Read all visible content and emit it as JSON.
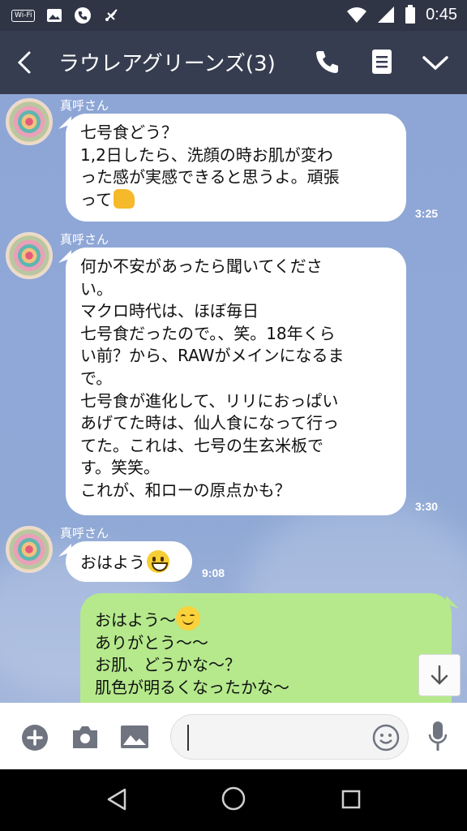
{
  "status_bar": {
    "wifi_label": "Wi-Fi",
    "time": "0:45"
  },
  "header": {
    "title": "ラウレアグリーンズ(3)"
  },
  "messages": [
    {
      "sender": "真呼さん",
      "lines": [
        "七号食どう？",
        "1,2日したら、洗顔の時お肌が変わ",
        "った感が実感できると思うよ。頑張",
        "って"
      ],
      "emoji": "thumbs-up",
      "time": "3:25"
    },
    {
      "sender": "真呼さん",
      "lines": [
        "何か不安があったら聞いてくださ",
        "い。",
        "マクロ時代は、ほぼ毎日",
        "七号食だったので。、笑。18年くら",
        "い前？から、RAWがメインになるま",
        "で。",
        "七号食が進化して、リリにおっぱい",
        "あげてた時は、仙人食になって行っ",
        "てた。これは、七号の生玄米板で",
        "す。笑笑。",
        "これが、和ローの原点かも？"
      ],
      "time": "3:30"
    },
    {
      "sender": "真呼さん",
      "lines": [
        "おはよう"
      ],
      "emoji": "grinning-face",
      "time": "9:08"
    }
  ],
  "my_message": {
    "lines": [
      "おはよう〜",
      "ありがとう〜〜",
      "お肌、どうかな〜？",
      "肌色が明るくなったかな〜"
    ],
    "emoji": "smiling-face"
  },
  "input": {
    "placeholder": ""
  },
  "colors": {
    "header_bg": "#363d50",
    "status_bg": "#2f3545",
    "chat_bg": "#8ea6d6",
    "my_bubble": "#b5e98c"
  }
}
